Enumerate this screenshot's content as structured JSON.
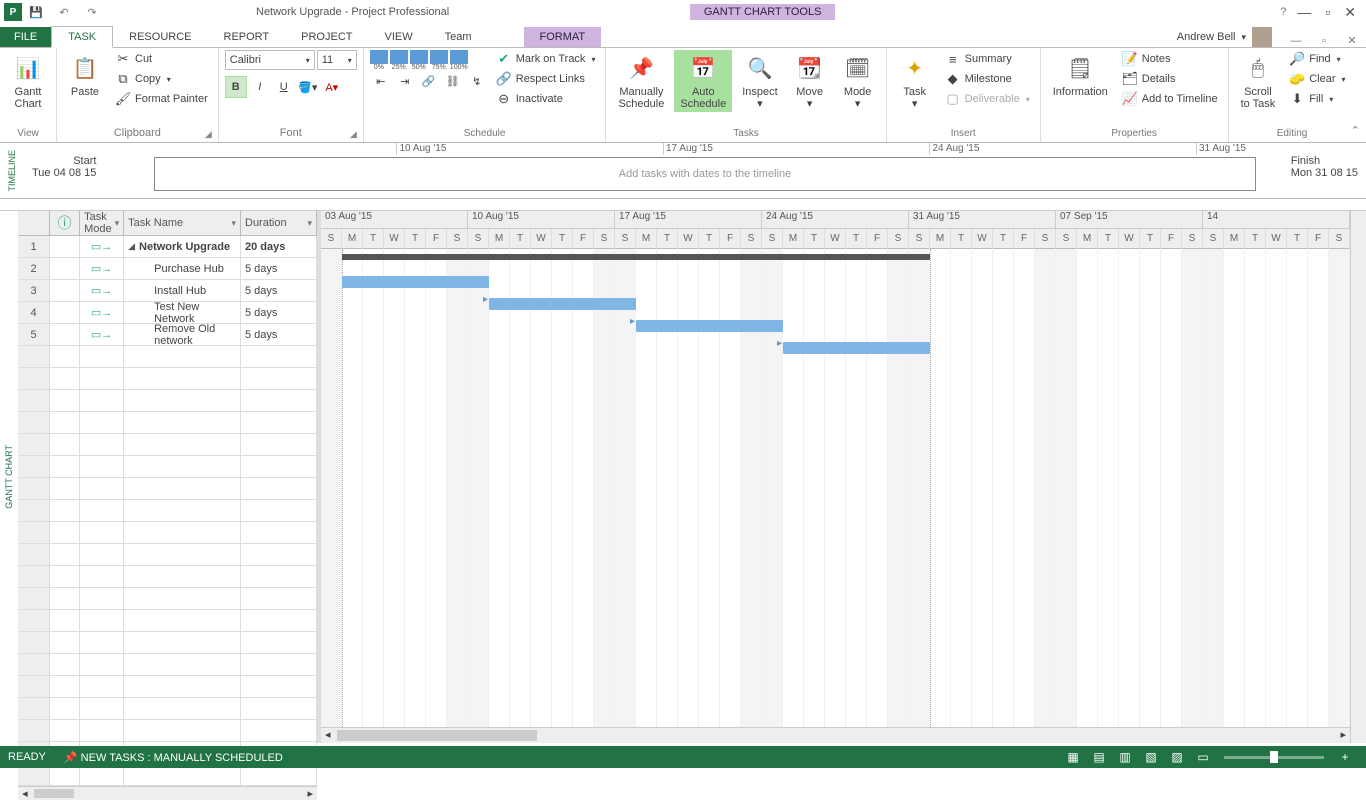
{
  "titlebar": {
    "title": "Network Upgrade - Project Professional",
    "contextual": "GANTT CHART TOOLS"
  },
  "user": {
    "name": "Andrew Bell"
  },
  "tabs": {
    "file": "FILE",
    "task": "TASK",
    "resource": "RESOURCE",
    "report": "REPORT",
    "project": "PROJECT",
    "view": "VIEW",
    "team": "Team",
    "format": "FORMAT"
  },
  "ribbon": {
    "view": {
      "gantt": "Gantt\nChart",
      "sub": "View"
    },
    "clipboard": {
      "paste": "Paste",
      "cut": "Cut",
      "copy": "Copy",
      "fp": "Format Painter",
      "label": "Clipboard"
    },
    "font": {
      "name": "Calibri",
      "size": "11",
      "label": "Font"
    },
    "schedule": {
      "mark": "Mark on Track",
      "respect": "Respect Links",
      "inactivate": "Inactivate",
      "label": "Schedule"
    },
    "tasks": {
      "manual": "Manually\nSchedule",
      "auto": "Auto\nSchedule",
      "inspect": "Inspect",
      "move": "Move",
      "mode": "Mode",
      "label": "Tasks"
    },
    "insert": {
      "task": "Task",
      "summary": "Summary",
      "milestone": "Milestone",
      "deliverable": "Deliverable",
      "label": "Insert"
    },
    "properties": {
      "info": "Information",
      "notes": "Notes",
      "details": "Details",
      "timeline": "Add to Timeline",
      "label": "Properties"
    },
    "editing": {
      "scroll": "Scroll\nto Task",
      "find": "Find",
      "clear": "Clear",
      "fill": "Fill",
      "label": "Editing"
    }
  },
  "timeline": {
    "sidelabel": "TIMELINE",
    "start_lbl": "Start",
    "start_date": "Tue 04 08 15",
    "finish_lbl": "Finish",
    "finish_date": "Mon 31 08 15",
    "placeholder": "Add tasks with dates to the timeline",
    "dates": [
      "10 Aug '15",
      "17 Aug '15",
      "24 Aug '15",
      "31 Aug '15"
    ]
  },
  "gantt": {
    "sidelabel": "GANTT CHART",
    "columns": {
      "mode": "Task\nMode",
      "name": "Task Name",
      "dur": "Duration"
    },
    "weeks": [
      "03 Aug '15",
      "10 Aug '15",
      "17 Aug '15",
      "24 Aug '15",
      "31 Aug '15",
      "07 Sep '15",
      "14"
    ],
    "days": [
      "S",
      "M",
      "T",
      "W",
      "T",
      "F",
      "S"
    ]
  },
  "tasks": [
    {
      "n": "1",
      "name": "Network Upgrade",
      "dur": "20 days",
      "bold": true,
      "summary": true,
      "start": 1,
      "len": 28
    },
    {
      "n": "2",
      "name": "Purchase Hub",
      "dur": "5 days",
      "indent": true,
      "start": 1,
      "len": 7
    },
    {
      "n": "3",
      "name": "Install Hub",
      "dur": "5 days",
      "indent": true,
      "start": 8,
      "len": 7
    },
    {
      "n": "4",
      "name": "Test New Network",
      "dur": "5 days",
      "indent": true,
      "start": 15,
      "len": 7
    },
    {
      "n": "5",
      "name": "Remove Old network",
      "dur": "5 days",
      "indent": true,
      "start": 22,
      "len": 7
    }
  ],
  "status": {
    "ready": "READY",
    "newtasks": "NEW TASKS : MANUALLY SCHEDULED"
  },
  "pct": [
    "0%",
    "25%",
    "50%",
    "75%",
    "100%"
  ]
}
